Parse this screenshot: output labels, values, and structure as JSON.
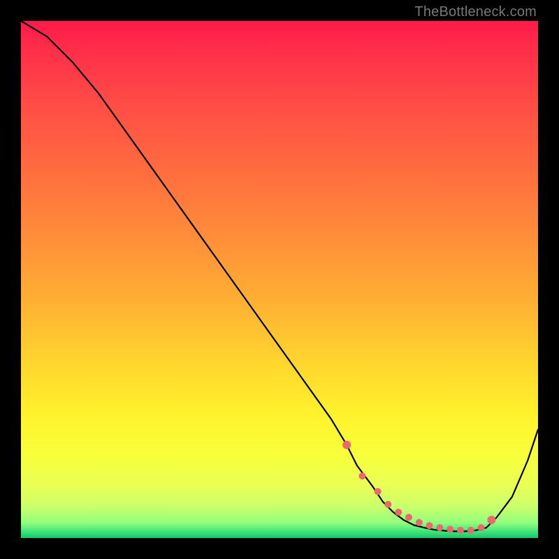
{
  "attribution": "TheBottleneck.com",
  "chart_data": {
    "type": "line",
    "title": "",
    "xlabel": "",
    "ylabel": "",
    "xlim": [
      0,
      100
    ],
    "ylim": [
      0,
      100
    ],
    "grid": false,
    "background": "heat-gradient",
    "series": [
      {
        "name": "bottleneck-curve",
        "x": [
          0,
          5,
          10,
          15,
          20,
          25,
          30,
          35,
          40,
          45,
          50,
          55,
          60,
          63,
          65,
          68,
          70,
          72,
          74,
          76,
          78,
          80,
          82,
          84,
          86,
          88,
          90,
          92,
          95,
          98,
          100
        ],
        "y": [
          100,
          97,
          92,
          86,
          79,
          72,
          65,
          58,
          51,
          44,
          37,
          30,
          23,
          18,
          14,
          10,
          7,
          5,
          3.5,
          2.5,
          2,
          1.6,
          1.4,
          1.3,
          1.3,
          1.5,
          2,
          4,
          8,
          15,
          21
        ]
      }
    ],
    "markers": {
      "name": "highlight-points",
      "color": "#e86a6a",
      "x": [
        63,
        66,
        69,
        71,
        73,
        75,
        77,
        79,
        81,
        83,
        85,
        87,
        89,
        91
      ],
      "y": [
        18,
        12,
        9,
        6.5,
        5,
        4,
        3,
        2.4,
        2,
        1.7,
        1.5,
        1.5,
        2,
        3.5
      ]
    }
  }
}
